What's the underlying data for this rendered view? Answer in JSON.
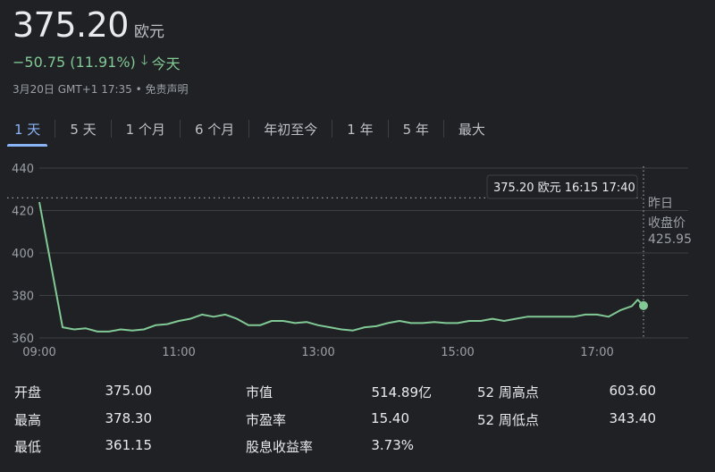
{
  "quote": {
    "price": "375.20",
    "currency": "欧元",
    "change": "−50.75 (11.91%)",
    "change_period": "今天",
    "timestamp": "3月20日 GMT+1 17:35",
    "disclaimer": "免责声明",
    "change_color": "#81c995"
  },
  "tabs": [
    "1 天",
    "5 天",
    "1 个月",
    "6 个月",
    "年初至今",
    "1 年",
    "5 年",
    "最大"
  ],
  "active_tab": "1 天",
  "tooltip": {
    "price": "375.20 欧元",
    "time_a": "16:15",
    "time_b": "17:40"
  },
  "prev_close": {
    "label_line1": "昨日",
    "label_line2": "收盘价",
    "value": "425.95"
  },
  "chart_data": {
    "type": "line",
    "x_ticks": [
      "09:00",
      "11:00",
      "13:00",
      "15:00",
      "17:00"
    ],
    "y_ticks": [
      360,
      380,
      400,
      420,
      440
    ],
    "ylim": [
      360,
      440
    ],
    "xlim": [
      "09:00",
      "17:40"
    ],
    "reference_line": 425.95,
    "line_color": "#81c995",
    "series": [
      {
        "x": [
          "09:00",
          "09:20",
          "09:30",
          "09:40",
          "09:50",
          "10:00",
          "10:10",
          "10:20",
          "10:30",
          "10:40",
          "10:50",
          "11:00",
          "11:10",
          "11:20",
          "11:30",
          "11:40",
          "11:50",
          "12:00",
          "12:10",
          "12:20",
          "12:30",
          "12:40",
          "12:50",
          "13:00",
          "13:10",
          "13:20",
          "13:30",
          "13:40",
          "13:50",
          "14:00",
          "14:10",
          "14:20",
          "14:30",
          "14:40",
          "14:50",
          "15:00",
          "15:10",
          "15:20",
          "15:30",
          "15:40",
          "15:50",
          "16:00",
          "16:10",
          "16:15",
          "16:30",
          "16:40",
          "16:50",
          "17:00",
          "17:10",
          "17:20",
          "17:30",
          "17:35",
          "17:40"
        ],
        "values": [
          424,
          365,
          364,
          364.5,
          363,
          363,
          364,
          363.5,
          364,
          366,
          366.5,
          368,
          369,
          371,
          370,
          371,
          369,
          366,
          366,
          368,
          368,
          367,
          367.5,
          366,
          365,
          364,
          363.5,
          365,
          365.5,
          367,
          368,
          367,
          367,
          367.5,
          367,
          367,
          368,
          368,
          369,
          368,
          369,
          370,
          370,
          370,
          370,
          370,
          371,
          371,
          370,
          373,
          375,
          378,
          375.2
        ]
      }
    ]
  },
  "stats": [
    {
      "label": "开盘",
      "value": "375.00"
    },
    {
      "label": "最高",
      "value": "378.30"
    },
    {
      "label": "最低",
      "value": "361.15"
    },
    {
      "label": "市值",
      "value": "514.89亿"
    },
    {
      "label": "市盈率",
      "value": "15.40"
    },
    {
      "label": "股息收益率",
      "value": "3.73%"
    },
    {
      "label": "52 周高点",
      "value": "603.60"
    },
    {
      "label": "52 周低点",
      "value": "343.40"
    }
  ]
}
